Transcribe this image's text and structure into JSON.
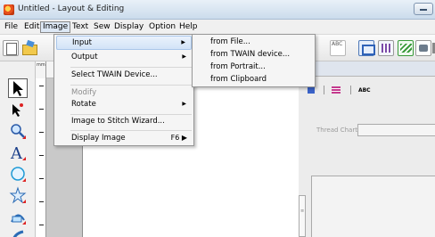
{
  "window": {
    "title": "Untitled - Layout & Editing"
  },
  "menubar": {
    "items": [
      "File",
      "Edit",
      "Image",
      "Text",
      "Sew",
      "Display",
      "Option",
      "Help"
    ],
    "active": "Image"
  },
  "toolbar": {
    "right_icon_text": "ABC"
  },
  "image_menu": {
    "items": [
      {
        "label": "Input",
        "submenu": true,
        "highlighted": true
      },
      {
        "label": "Output",
        "submenu": true
      },
      {
        "label": "Select TWAIN Device..."
      },
      {
        "label": "Modify",
        "disabled": true
      },
      {
        "label": "Rotate",
        "submenu": true
      },
      {
        "label": "Image to Stitch Wizard..."
      },
      {
        "label": "Display Image",
        "shortcut": "F6",
        "submenu": true
      }
    ]
  },
  "input_submenu": {
    "items": [
      "from File...",
      "from TWAIN device...",
      "from Portrait...",
      "from Clipboard"
    ]
  },
  "right_panel": {
    "tab_abc": "ABC",
    "thread_chart_label": "Thread Chart:"
  },
  "ruler": {
    "corner_label": "mm"
  }
}
